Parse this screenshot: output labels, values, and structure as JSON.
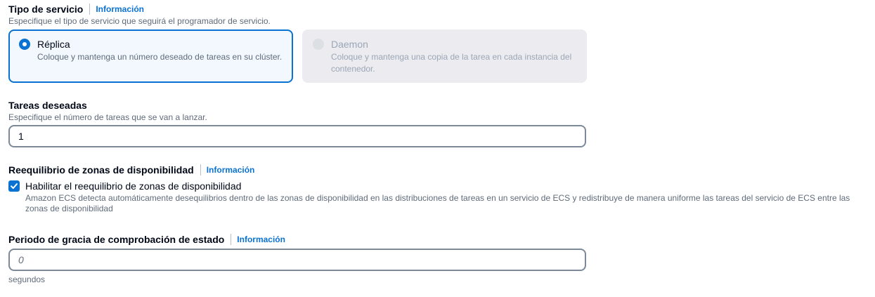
{
  "service_type": {
    "label": "Tipo de servicio",
    "info": "Información",
    "description": "Especifique el tipo de servicio que seguirá el programador de servicio.",
    "options": [
      {
        "title": "Réplica",
        "description": "Coloque y mantenga un número deseado de tareas en su clúster.",
        "selected": true,
        "disabled": false
      },
      {
        "title": "Daemon",
        "description": "Coloque y mantenga una copia de la tarea en cada instancia del contenedor.",
        "selected": false,
        "disabled": true
      }
    ]
  },
  "desired_tasks": {
    "label": "Tareas deseadas",
    "description": "Especifique el número de tareas que se van a lanzar.",
    "value": "1"
  },
  "az_rebalancing": {
    "label": "Reequilibrio de zonas de disponibilidad",
    "info": "Información",
    "checkbox_label": "Habilitar el reequilibrio de zonas de disponibilidad",
    "checked": true,
    "checkbox_description": "Amazon ECS detecta automáticamente desequilibrios dentro de las zonas de disponibilidad en las distribuciones de tareas en un servicio de ECS y redistribuye de manera uniforme las tareas del servicio de ECS entre las zonas de disponibilidad"
  },
  "health_check_grace": {
    "label": "Periodo de gracia de comprobación de estado",
    "info": "Información",
    "placeholder": "0",
    "unit": "segundos"
  },
  "colors": {
    "accent": "#0972d3",
    "text": "#000716",
    "secondary_text": "#5f6b7a",
    "disabled_bg": "#ebebf0"
  }
}
